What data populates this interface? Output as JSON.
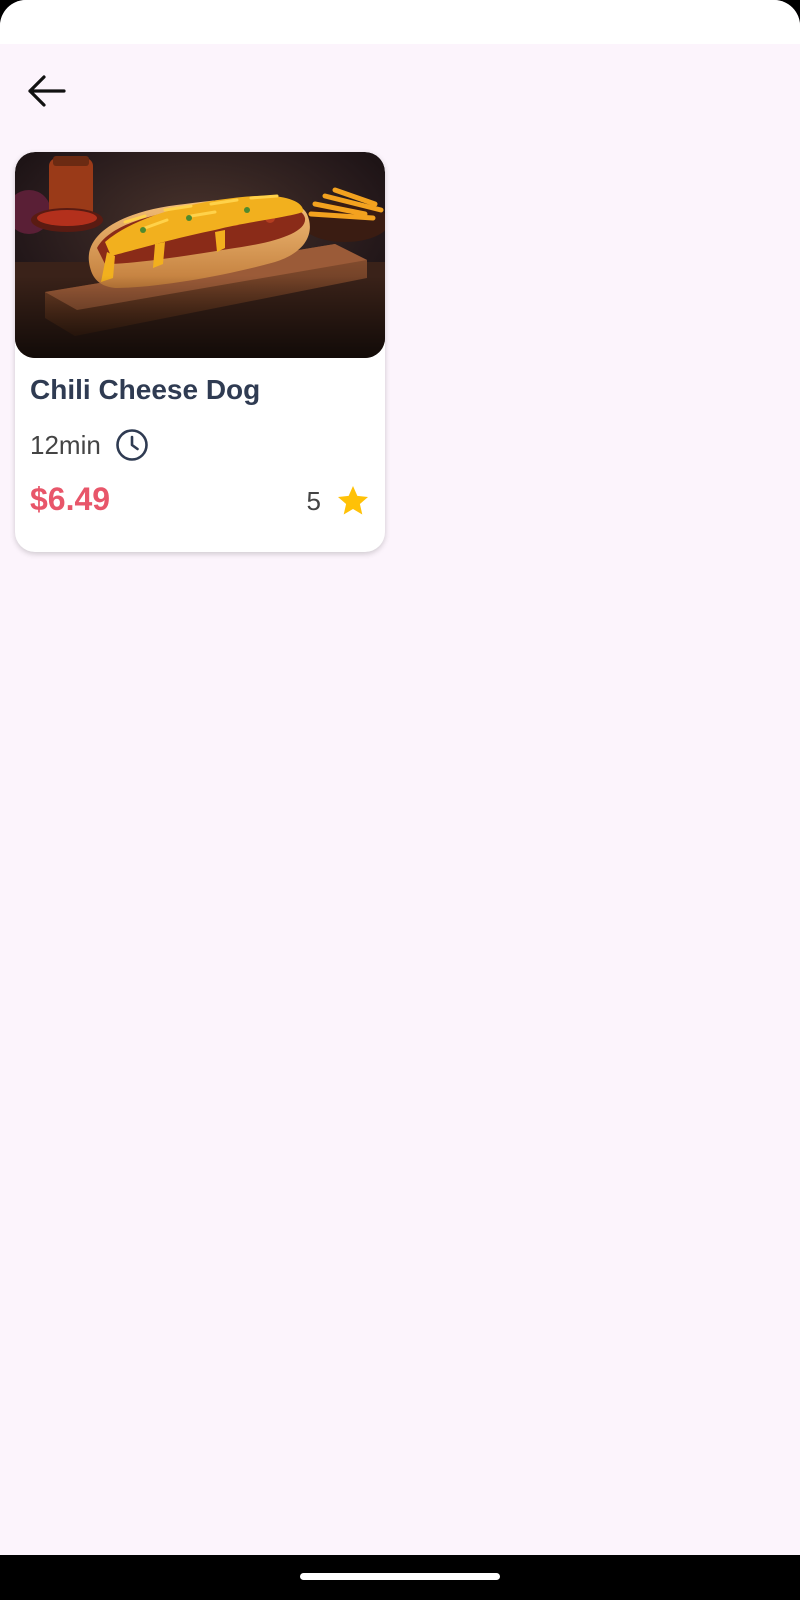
{
  "nav": {
    "back_icon": "arrow-left-icon"
  },
  "item": {
    "image_desc": "chili cheese dog on wooden board",
    "title": "Chili Cheese Dog",
    "time": "12min",
    "time_icon": "clock-icon",
    "price": "$6.49",
    "rating": "5",
    "rating_icon": "star-icon"
  },
  "colors": {
    "background": "#fcf4fc",
    "card": "#ffffff",
    "title": "#2f3b52",
    "price": "#e8566a",
    "star": "#ffc107",
    "clock": "#2f3b52"
  }
}
